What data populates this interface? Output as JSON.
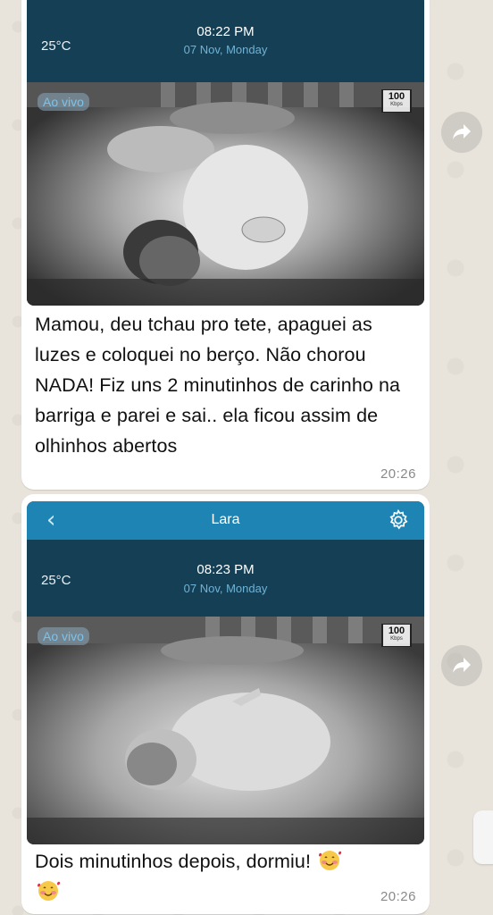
{
  "messages": [
    {
      "screenshot": {
        "temperature": "25°C",
        "time": "08:22 PM",
        "date": "07 Nov, Monday",
        "live_label": "Ao vivo",
        "bitrate_value": "100",
        "bitrate_unit": "Kbps"
      },
      "text": "Mamou, deu tchau pro tete, apaguei as luzes e coloquei no berço. Não chorou NADA! Fiz uns 2 minutinhos de carinho na barriga e parei e sai.. ela ficou assim de olhinhos abertos",
      "timestamp": "20:26"
    },
    {
      "screenshot": {
        "app_title": "Lara",
        "back_icon": "chevron-left-icon",
        "settings_icon": "gear-icon",
        "temperature": "25°C",
        "time": "08:23 PM",
        "date": "07 Nov, Monday",
        "live_label": "Ao vivo",
        "bitrate_value": "100",
        "bitrate_unit": "Kbps"
      },
      "text": "Dois minutinhos depois, dormiu!",
      "emoji": "smiling-face-with-hearts",
      "timestamp": "20:26"
    }
  ],
  "forward_icon": "forward-arrow-icon",
  "colors": {
    "app_bar": "#1e84b3",
    "info_bar": "#153f55",
    "date_text": "#6fb3d6",
    "live_text": "#7cc2ea",
    "bubble": "#ffffff",
    "chat_background": "#e9e4db"
  }
}
